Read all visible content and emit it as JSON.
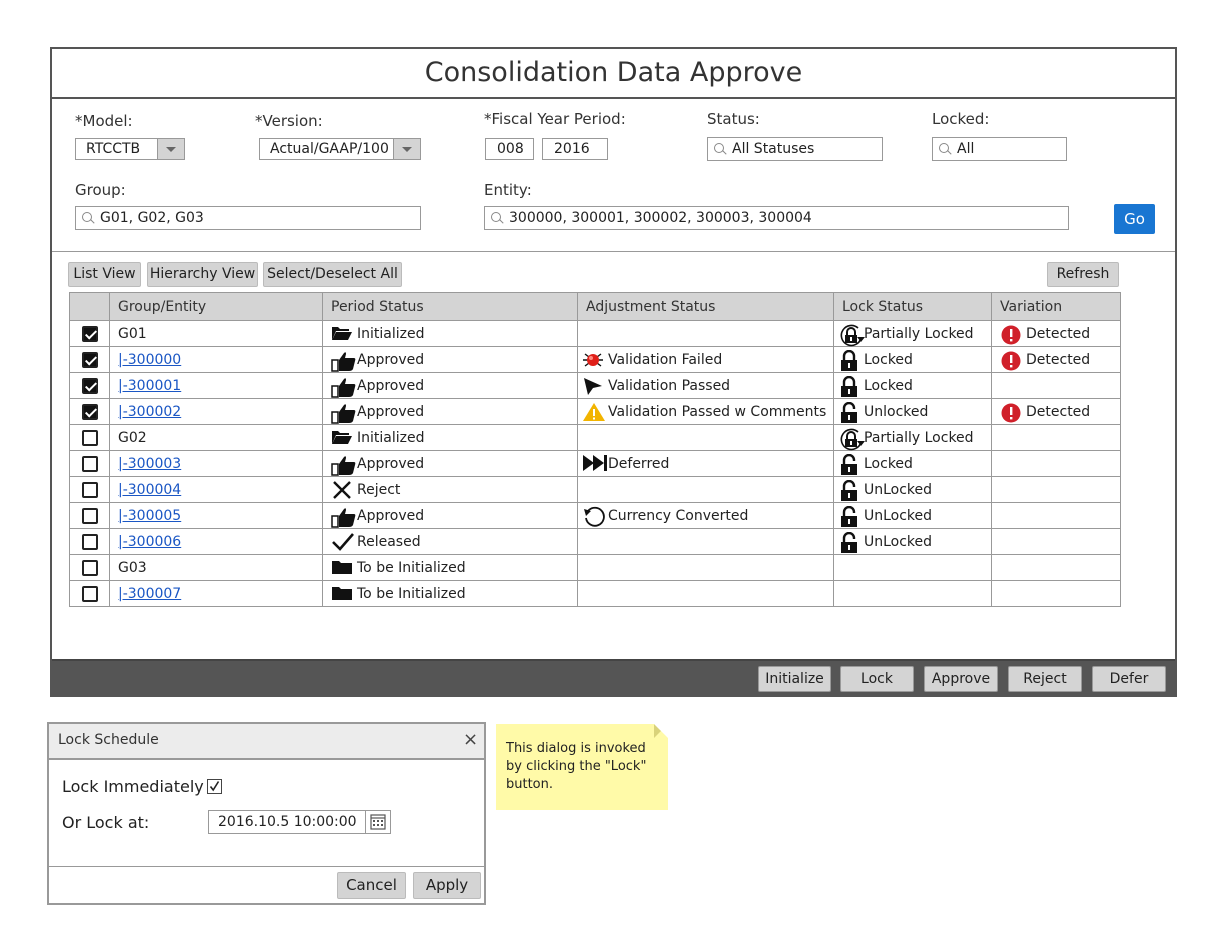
{
  "title": "Consolidation Data Approve",
  "filters": {
    "model_label": "*Model:",
    "model_value": "RTCCTB",
    "version_label": "*Version:",
    "version_value": "Actual/GAAP/100",
    "fiscal_label": "*Fiscal Year Period:",
    "fiscal_period": "008",
    "fiscal_year": "2016",
    "status_label": "Status:",
    "status_value": "All Statuses",
    "locked_label": "Locked:",
    "locked_value": "All",
    "group_label": "Group:",
    "group_value": "G01, G02, G03",
    "entity_label": "Entity:",
    "entity_value": "300000, 300001, 300002, 300003, 300004",
    "go_label": "Go"
  },
  "toolbar": {
    "list_view": "List View",
    "hierarchy_view": "Hierarchy View",
    "select_all": "Select/Deselect All",
    "refresh": "Refresh"
  },
  "table": {
    "headers": [
      "Group/Entity",
      "Period Status",
      "Adjustment Status",
      "Lock Status",
      "Variation"
    ],
    "rows": [
      {
        "checked": true,
        "entity": "G01",
        "link": false,
        "period_icon": "folder-open-icon",
        "period": "Initialized",
        "adj_icon": "",
        "adj": "",
        "lock_icon": "partial-lock-icon",
        "lock": "Partially Locked",
        "var_icon": "alert-icon",
        "variation": "Detected"
      },
      {
        "checked": true,
        "entity": "|-300000",
        "link": true,
        "period_icon": "thumbs-up-icon",
        "period": "Approved",
        "adj_icon": "red-bug-icon",
        "adj": "Validation Failed",
        "lock_icon": "lock-icon",
        "lock": "Locked",
        "var_icon": "alert-icon",
        "variation": "Detected"
      },
      {
        "checked": true,
        "entity": "|-300001",
        "link": true,
        "period_icon": "thumbs-up-icon",
        "period": "Approved",
        "adj_icon": "cursor-icon",
        "adj": "Validation Passed",
        "lock_icon": "lock-icon",
        "lock": "Locked",
        "var_icon": "",
        "variation": ""
      },
      {
        "checked": true,
        "entity": "|-300002",
        "link": true,
        "period_icon": "thumbs-up-icon",
        "period": "Approved",
        "adj_icon": "warning-icon",
        "adj": "Validation Passed w Comments",
        "lock_icon": "unlock-icon",
        "lock": "Unlocked",
        "var_icon": "alert-icon",
        "variation": "Detected"
      },
      {
        "checked": false,
        "entity": "G02",
        "link": false,
        "period_icon": "folder-open-icon",
        "period": "Initialized",
        "adj_icon": "",
        "adj": "",
        "lock_icon": "partial-lock-icon",
        "lock": "Partially Locked",
        "var_icon": "",
        "variation": ""
      },
      {
        "checked": false,
        "entity": "|-300003",
        "link": true,
        "period_icon": "thumbs-up-icon",
        "period": "Approved",
        "adj_icon": "fast-forward-icon",
        "adj": "Deferred",
        "lock_icon": "unlock-icon",
        "lock": "Locked",
        "var_icon": "",
        "variation": ""
      },
      {
        "checked": false,
        "entity": "|-300004",
        "link": true,
        "period_icon": "x-icon",
        "period": "Reject",
        "adj_icon": "",
        "adj": "",
        "lock_icon": "unlock-icon",
        "lock": "UnLocked",
        "var_icon": "",
        "variation": ""
      },
      {
        "checked": false,
        "entity": "|-300005",
        "link": true,
        "period_icon": "thumbs-up-icon",
        "period": "Approved",
        "adj_icon": "refresh-icon",
        "adj": "Currency Converted",
        "lock_icon": "unlock-icon",
        "lock": "UnLocked",
        "var_icon": "",
        "variation": ""
      },
      {
        "checked": false,
        "entity": "|-300006",
        "link": true,
        "period_icon": "check-icon",
        "period": "Released",
        "adj_icon": "",
        "adj": "",
        "lock_icon": "unlock-icon",
        "lock": "UnLocked",
        "var_icon": "",
        "variation": ""
      },
      {
        "checked": false,
        "entity": "G03",
        "link": false,
        "period_icon": "folder-icon",
        "period": "To be Initialized",
        "adj_icon": "",
        "adj": "",
        "lock_icon": "",
        "lock": "",
        "var_icon": "",
        "variation": ""
      },
      {
        "checked": false,
        "entity": "|-300007",
        "link": true,
        "period_icon": "folder-icon",
        "period": "To be Initialized",
        "adj_icon": "",
        "adj": "",
        "lock_icon": "",
        "lock": "",
        "var_icon": "",
        "variation": ""
      }
    ]
  },
  "footer": {
    "initialize": "Initialize",
    "lock": "Lock",
    "approve": "Approve",
    "reject": "Reject",
    "defer": "Defer"
  },
  "dialog": {
    "title": "Lock Schedule",
    "close": "×",
    "lock_immediately": "Lock Immediately",
    "lock_at_label": "Or Lock at:",
    "lock_at_value": "2016.10.5 10:00:00",
    "cancel": "Cancel",
    "apply": "Apply"
  },
  "note": {
    "text": "This dialog is invoked by clicking the \"Lock\" button."
  },
  "colors": {
    "accent": "#1976d2",
    "alert": "#d0202a",
    "warning": "#f2b400",
    "note": "#fffaa8",
    "footer": "#555555"
  }
}
